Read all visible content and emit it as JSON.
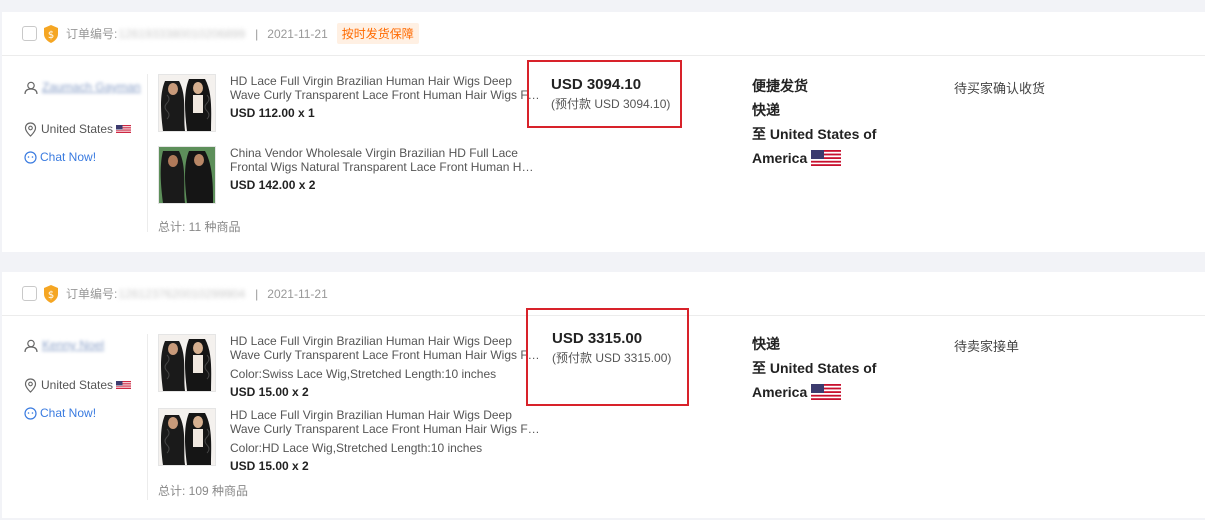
{
  "orders": [
    {
      "order_no_label": "订单编号:",
      "order_no": "1261933380010206899",
      "date": "2021-11-21",
      "guarantee": "按时发货保障",
      "buyer_name": "Zaumach Gayman",
      "country": "United States",
      "chat": "Chat Now!",
      "products": [
        {
          "name": "HD Lace Full Virgin Brazilian Human Hair Wigs Deep Wave Curly Transparent Lace Front Human Hair Wigs For Women",
          "variant": "",
          "price": "USD 112.00 x 1"
        },
        {
          "name": "China Vendor Wholesale Virgin Brazilian HD Full Lace Frontal Wigs Natural Transparent Lace Front Human Hair Wigs",
          "variant": "",
          "price": "USD 142.00 x 2"
        }
      ],
      "total": "总计: 11 种商品",
      "amount": "USD 3094.10",
      "prepay": "(预付款 USD 3094.10)",
      "shipping": {
        "line1": "便捷发货",
        "line2": "快递",
        "line3": "至 United States of America"
      },
      "status": "待买家确认收货"
    },
    {
      "order_no_label": "订单编号:",
      "order_no": "1261237620010299904",
      "date": "2021-11-21",
      "guarantee": "",
      "buyer_name": "Kenny Noel",
      "country": "United States",
      "chat": "Chat Now!",
      "products": [
        {
          "name": "HD Lace Full Virgin Brazilian Human Hair Wigs Deep Wave Curly Transparent Lace Front Human Hair Wigs For Women",
          "variant": "Color:Swiss Lace Wig,Stretched Length:10 inches",
          "price": "USD 15.00 x 2"
        },
        {
          "name": "HD Lace Full Virgin Brazilian Human Hair Wigs Deep Wave Curly Transparent Lace Front Human Hair Wigs For Women",
          "variant": "Color:HD Lace Wig,Stretched Length:10 inches",
          "price": "USD 15.00 x 2"
        }
      ],
      "total": "总计: 109 种商品",
      "amount": "USD 3315.00",
      "prepay": "(预付款 USD 3315.00)",
      "shipping": {
        "line1": "",
        "line2": "快递",
        "line3": "至 United States of America"
      },
      "status": "待卖家接单"
    }
  ],
  "colors": {
    "accent": "#ff6a00",
    "highlight_border": "#d8222a",
    "link": "#3a7be0"
  }
}
